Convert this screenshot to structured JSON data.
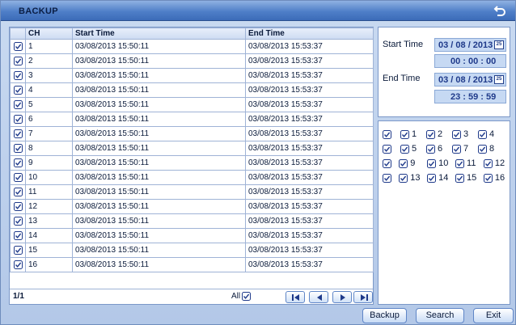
{
  "window": {
    "title": "BACKUP"
  },
  "columns": {
    "ch": "CH",
    "start": "Start Time",
    "end": "End Time"
  },
  "rows": [
    {
      "ch": "1",
      "start": "03/08/2013 15:50:11",
      "end": "03/08/2013 15:53:37"
    },
    {
      "ch": "2",
      "start": "03/08/2013 15:50:11",
      "end": "03/08/2013 15:53:37"
    },
    {
      "ch": "3",
      "start": "03/08/2013 15:50:11",
      "end": "03/08/2013 15:53:37"
    },
    {
      "ch": "4",
      "start": "03/08/2013 15:50:11",
      "end": "03/08/2013 15:53:37"
    },
    {
      "ch": "5",
      "start": "03/08/2013 15:50:11",
      "end": "03/08/2013 15:53:37"
    },
    {
      "ch": "6",
      "start": "03/08/2013 15:50:11",
      "end": "03/08/2013 15:53:37"
    },
    {
      "ch": "7",
      "start": "03/08/2013 15:50:11",
      "end": "03/08/2013 15:53:37"
    },
    {
      "ch": "8",
      "start": "03/08/2013 15:50:11",
      "end": "03/08/2013 15:53:37"
    },
    {
      "ch": "9",
      "start": "03/08/2013 15:50:11",
      "end": "03/08/2013 15:53:37"
    },
    {
      "ch": "10",
      "start": "03/08/2013 15:50:11",
      "end": "03/08/2013 15:53:37"
    },
    {
      "ch": "11",
      "start": "03/08/2013 15:50:11",
      "end": "03/08/2013 15:53:37"
    },
    {
      "ch": "12",
      "start": "03/08/2013 15:50:11",
      "end": "03/08/2013 15:53:37"
    },
    {
      "ch": "13",
      "start": "03/08/2013 15:50:11",
      "end": "03/08/2013 15:53:37"
    },
    {
      "ch": "14",
      "start": "03/08/2013 15:50:11",
      "end": "03/08/2013 15:53:37"
    },
    {
      "ch": "15",
      "start": "03/08/2013 15:50:11",
      "end": "03/08/2013 15:53:37"
    },
    {
      "ch": "16",
      "start": "03/08/2013 15:50:11",
      "end": "03/08/2013 15:53:37"
    }
  ],
  "list_footer": {
    "page": "1/1",
    "all_label": "All"
  },
  "time_panel": {
    "start_label": "Start Time",
    "start_date": "03 / 08 / 2013",
    "start_time": "00 : 00 : 00",
    "end_label": "End Time",
    "end_date": "03 / 08 / 2013",
    "end_time": "23 : 59 : 59",
    "calendar_icon_text": "25"
  },
  "channels": [
    "1",
    "2",
    "3",
    "4",
    "5",
    "6",
    "7",
    "8",
    "9",
    "10",
    "11",
    "12",
    "13",
    "14",
    "15",
    "16"
  ],
  "buttons": {
    "backup": "Backup",
    "search": "Search",
    "exit": "Exit"
  },
  "colors": {
    "title_bar": "#4f7fc8",
    "accent": "#1f3a8a",
    "field_bg": "#c6d9f3"
  },
  "icons": {
    "back": "back-arrow-icon",
    "checkbox": "checked-checkbox-icon"
  }
}
